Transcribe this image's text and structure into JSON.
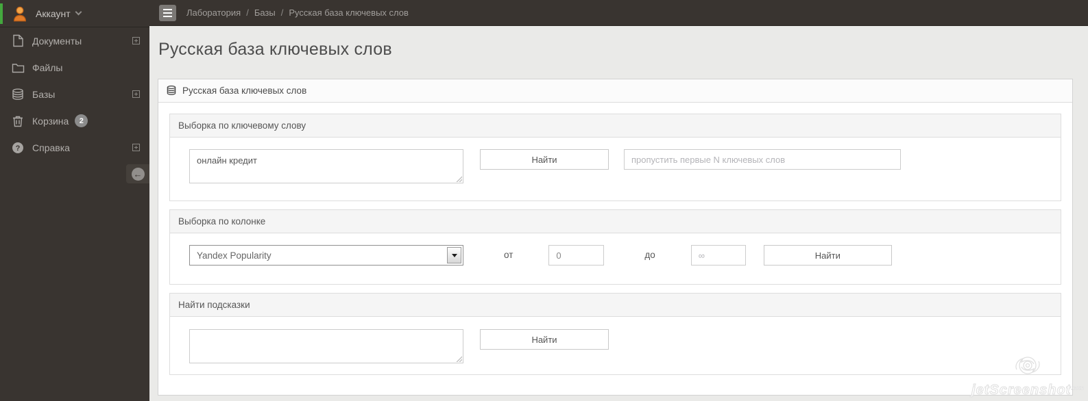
{
  "colors": {
    "sidebar-bg": "#393430",
    "topbar-bg": "#393430",
    "content-bg": "#eaeae8",
    "accent-green": "#44a83e",
    "panel-border": "#d2d2d2",
    "section-header-bg": "#f5f5f5",
    "badge-bg": "#8c8c8c",
    "input-border": "#cccccc",
    "text-dark": "#4d4d4d",
    "sidebar-text": "#b3b0ad"
  },
  "sidebar": {
    "account_label": "Аккаунт",
    "items": [
      {
        "label": "Документы",
        "icon": "document-icon",
        "expandable": true
      },
      {
        "label": "Файлы",
        "icon": "folder-icon",
        "expandable": false
      },
      {
        "label": "Базы",
        "icon": "database-icon",
        "expandable": true
      },
      {
        "label": "Корзина",
        "icon": "trash-icon",
        "badge": "2",
        "expandable": false
      },
      {
        "label": "Справка",
        "icon": "help-icon",
        "expandable": true
      }
    ]
  },
  "topbar": {
    "breadcrumb": [
      "Лаборатория",
      "Базы",
      "Русская база ключевых слов"
    ],
    "separator": "/"
  },
  "page": {
    "title": "Русская база ключевых слов"
  },
  "panel": {
    "title": "Русская база ключевых слов",
    "sections": {
      "keyword": {
        "header": "Выборка по ключевому слову",
        "textarea_value": "онлайн кредит",
        "search_button": "Найти",
        "skip_placeholder": "пропустить первые N ключевых слов"
      },
      "column": {
        "header": "Выборка по колонке",
        "select_value": "Yandex Popularity",
        "from_label": "от",
        "from_value": "0",
        "to_label": "до",
        "to_placeholder": "∞",
        "search_button": "Найти"
      },
      "hints": {
        "header": "Найти подсказки",
        "textarea_value": "",
        "search_button": "Найти"
      }
    }
  },
  "watermark": {
    "text": "jetScreenshot",
    "suffix": ".com"
  }
}
